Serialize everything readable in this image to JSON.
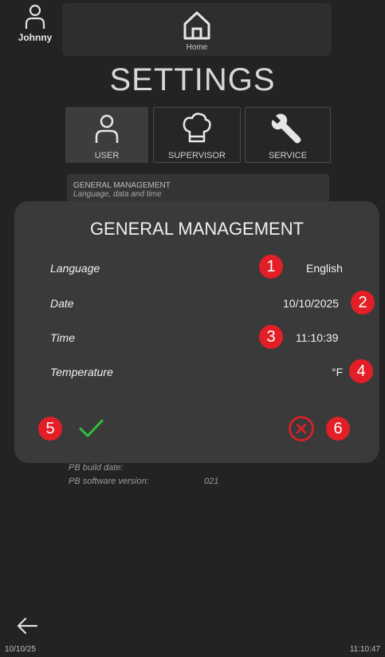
{
  "user": {
    "name": "Johnny"
  },
  "nav": {
    "home_label": "Home"
  },
  "page": {
    "title": "SETTINGS"
  },
  "tabs": [
    {
      "label": "USER",
      "icon": "user-icon",
      "active": true
    },
    {
      "label": "SUPERVISOR",
      "icon": "chef-hat-icon",
      "active": false
    },
    {
      "label": "SERVICE",
      "icon": "wrench-icon",
      "active": false
    }
  ],
  "settings_list": {
    "general": {
      "title": "GENERAL MANAGEMENT",
      "subtitle": "Language, data and time"
    }
  },
  "info": {
    "pb_build_date_label": "PB build date:",
    "pb_software_version_label": "PB software version:",
    "pb_software_version_value": "021"
  },
  "modal": {
    "title": "GENERAL MANAGEMENT",
    "fields": [
      {
        "label": "Language",
        "value": "English",
        "badge": "1"
      },
      {
        "label": "Date",
        "value": "10/10/2025",
        "badge": "2"
      },
      {
        "label": "Time",
        "value": "11:10:39",
        "badge": "3"
      },
      {
        "label": "Temperature",
        "value": "°F",
        "badge": "4"
      }
    ],
    "confirm_badge": "5",
    "cancel_badge": "6"
  },
  "footer": {
    "date": "10/10/25",
    "time": "11:10:47"
  },
  "colors": {
    "background": "#232323",
    "modal": "#3a3a3a",
    "badge": "#e21f26",
    "confirm": "#2fbf3a",
    "cancel": "#e21f26"
  }
}
